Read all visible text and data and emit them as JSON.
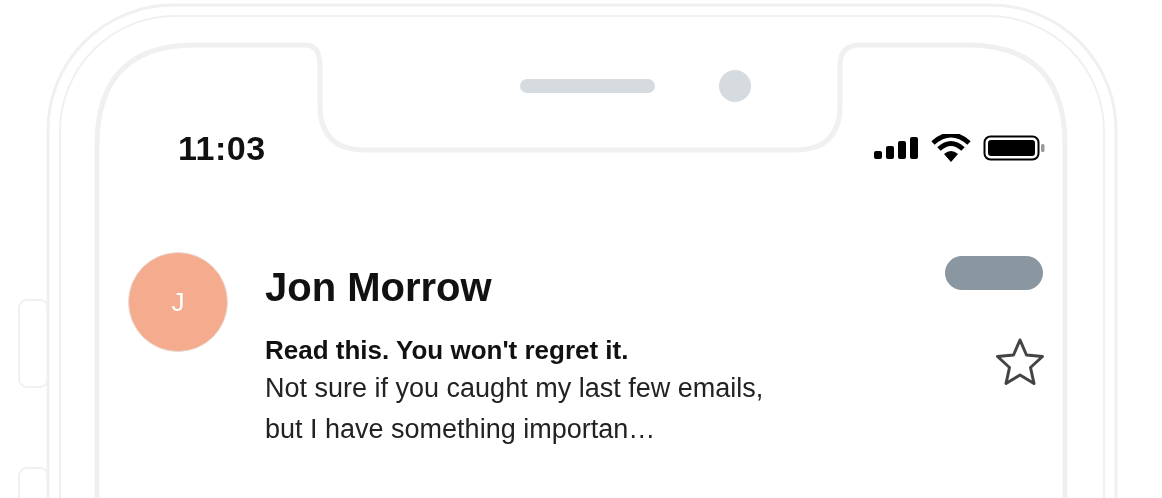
{
  "status_bar": {
    "time": "11:03"
  },
  "email": {
    "avatar_initial": "J",
    "sender": "Jon Morrow",
    "subject": "Read this. You won't regret it.",
    "preview_lines": [
      "Not sure if you caught my last few emails,",
      "but I have something importan…"
    ],
    "starred": false
  }
}
